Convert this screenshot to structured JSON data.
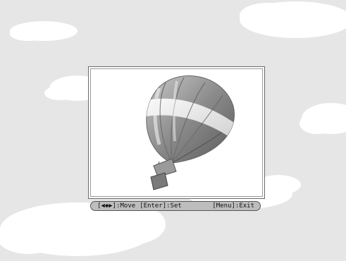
{
  "help_bar": {
    "move_hint": "[◀◆▶]:Move",
    "set_hint": "[Enter]:Set",
    "exit_hint": "[Menu]:Exit"
  },
  "colors": {
    "background": "#e6e6e6",
    "cloud": "#ffffff",
    "frame_border": "#6a6a6a",
    "help_bar_bg": "#bdbdbd"
  },
  "icons": {
    "preview_image": "hot-air-balloon"
  }
}
